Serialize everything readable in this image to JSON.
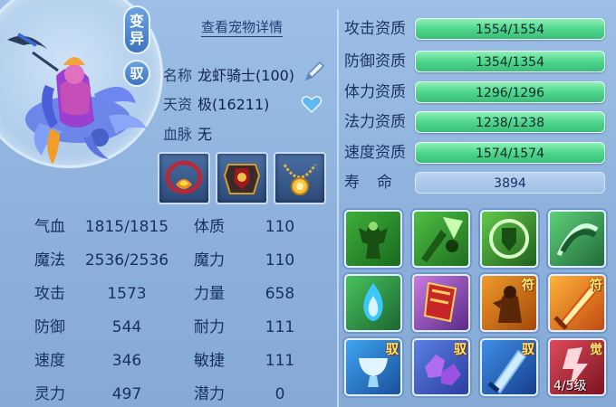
{
  "pet": {
    "tag_mutation": "变异",
    "tag_yu": "驭",
    "detail_link": "查看宠物详情",
    "name_label": "名称",
    "name_value": "龙虾骑士(100)",
    "talent_label": "天资",
    "talent_value": "极(16211)",
    "blood_label": "血脉",
    "blood_value": "无"
  },
  "equipment": [
    {
      "icon": "fire-necklace-icon"
    },
    {
      "icon": "armor-icon"
    },
    {
      "icon": "gold-necklace-icon"
    }
  ],
  "stats": [
    {
      "l1": "气血",
      "v1": "1815/1815",
      "l2": "体质",
      "v2": "110"
    },
    {
      "l1": "魔法",
      "v1": "2536/2536",
      "l2": "魔力",
      "v2": "110"
    },
    {
      "l1": "攻击",
      "v1": "1573",
      "l2": "力量",
      "v2": "658"
    },
    {
      "l1": "防御",
      "v1": "544",
      "l2": "耐力",
      "v2": "111"
    },
    {
      "l1": "速度",
      "v1": "346",
      "l2": "敏捷",
      "v2": "111"
    },
    {
      "l1": "灵力",
      "v1": "497",
      "l2": "潜力",
      "v2": "0"
    }
  ],
  "aptitudes": [
    {
      "label": "攻击资质",
      "value": "1554/1554"
    },
    {
      "label": "防御资质",
      "value": "1354/1354"
    },
    {
      "label": "体力资质",
      "value": "1296/1296"
    },
    {
      "label": "法力资质",
      "value": "1238/1238"
    },
    {
      "label": "速度资质",
      "value": "1574/1574"
    }
  ],
  "lifespan": {
    "label": "寿命",
    "value": "3894"
  },
  "skills": [
    {
      "icon": "green-warrior-icon",
      "badge": ""
    },
    {
      "icon": "green-strike-icon",
      "badge": ""
    },
    {
      "icon": "green-shield-icon",
      "badge": ""
    },
    {
      "icon": "green-claw-icon",
      "badge": ""
    },
    {
      "icon": "blue-flame-icon",
      "badge": ""
    },
    {
      "icon": "red-banner-icon",
      "badge": ""
    },
    {
      "icon": "orange-brute-icon",
      "badge": "符"
    },
    {
      "icon": "fire-sword-icon",
      "badge": "符"
    },
    {
      "icon": "blue-cup-icon",
      "badge": "驭"
    },
    {
      "icon": "purple-gem-icon",
      "badge": "驭"
    },
    {
      "icon": "blue-blade-icon",
      "badge": "驭"
    },
    {
      "icon": "red-awaken-icon",
      "badge": "觉",
      "level": "4/5级"
    }
  ],
  "colors": {
    "aptitude_bar": "#4fd68d",
    "background": "#8fb3dd",
    "text": "#17305c"
  }
}
